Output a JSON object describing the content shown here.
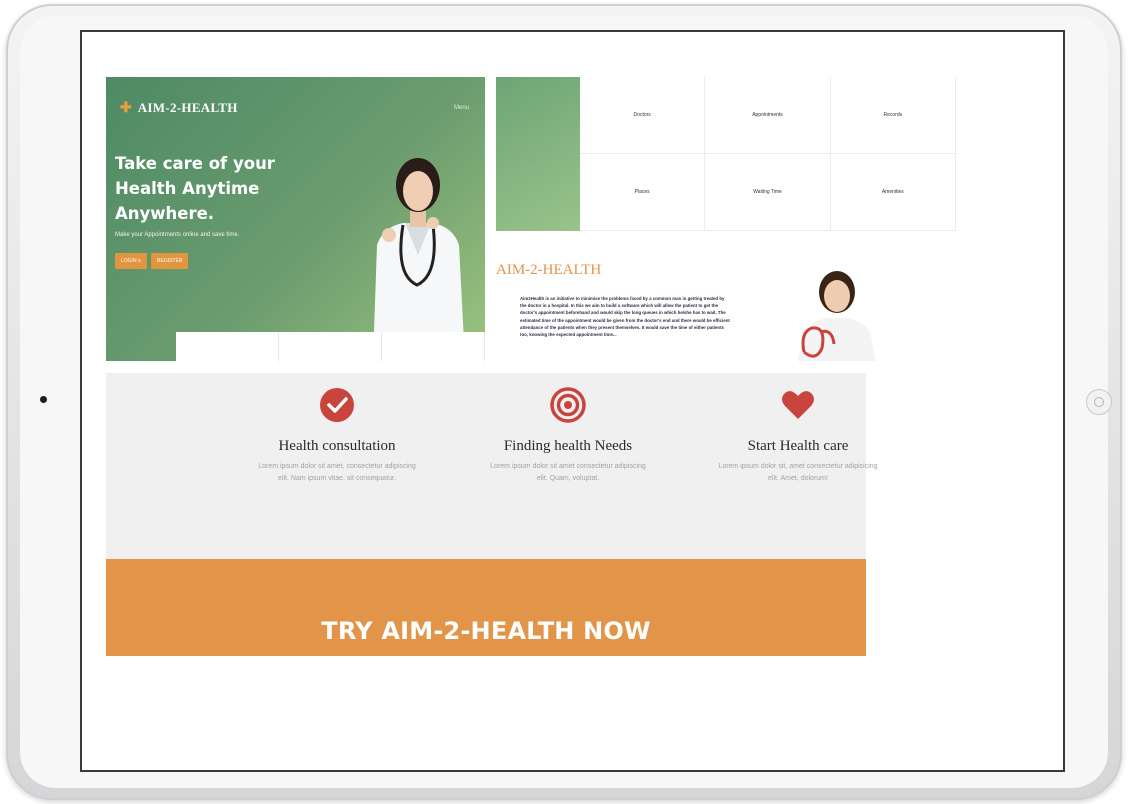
{
  "brand": {
    "name": "AIM-2-HEALTH"
  },
  "hero": {
    "menu": "Menu",
    "title": "Take care of your Health Anytime Anywhere.",
    "subtitle": "Make your Appointments online and save time.",
    "buttons": [
      "LOGIN ≡",
      "REGISTER"
    ]
  },
  "grid": {
    "cells": [
      "Doctors",
      "Appointments",
      "Records",
      "Places",
      "Waiting Time",
      "Amenities"
    ]
  },
  "about": {
    "title": "AIM-2-HEALTH",
    "text": "Aim2Health is an initiative to minimise the problems faced by a common man in getting treated by the doctor in a hospital. In this we aim to build a software which will allow the patient to get the doctor's appointment beforehand and would skip the long queues in which he/she has to wait. The estimated time of the appointment would be given from the doctor's end and there would be efficient attendance of the patients when they present themselves. It would save the time of either patients too, knowing the expected appointment time..."
  },
  "features": [
    {
      "icon": "check-circle-icon",
      "title": "Health consultation",
      "desc": "Lorem ipsum dolor sit amet, consectetur adipiscing elit. Nam ipsum vitae, sit consequatur."
    },
    {
      "icon": "target-icon",
      "title": "Finding health Needs",
      "desc": "Lorem ipsum dolor sit amet consectetur adipiscing elit. Quam, voluptat."
    },
    {
      "icon": "heart-icon",
      "title": "Start Health care",
      "desc": "Lorem ipsum dolor sit, amet consectetur adipisicing elit. Amet, dolorum!"
    }
  ],
  "cta": {
    "text": "TRY AIM-2-HEALTH NOW"
  },
  "colors": {
    "accent": "#e29448",
    "icon_red": "#c8443c",
    "hero_green": "#5e9368"
  }
}
